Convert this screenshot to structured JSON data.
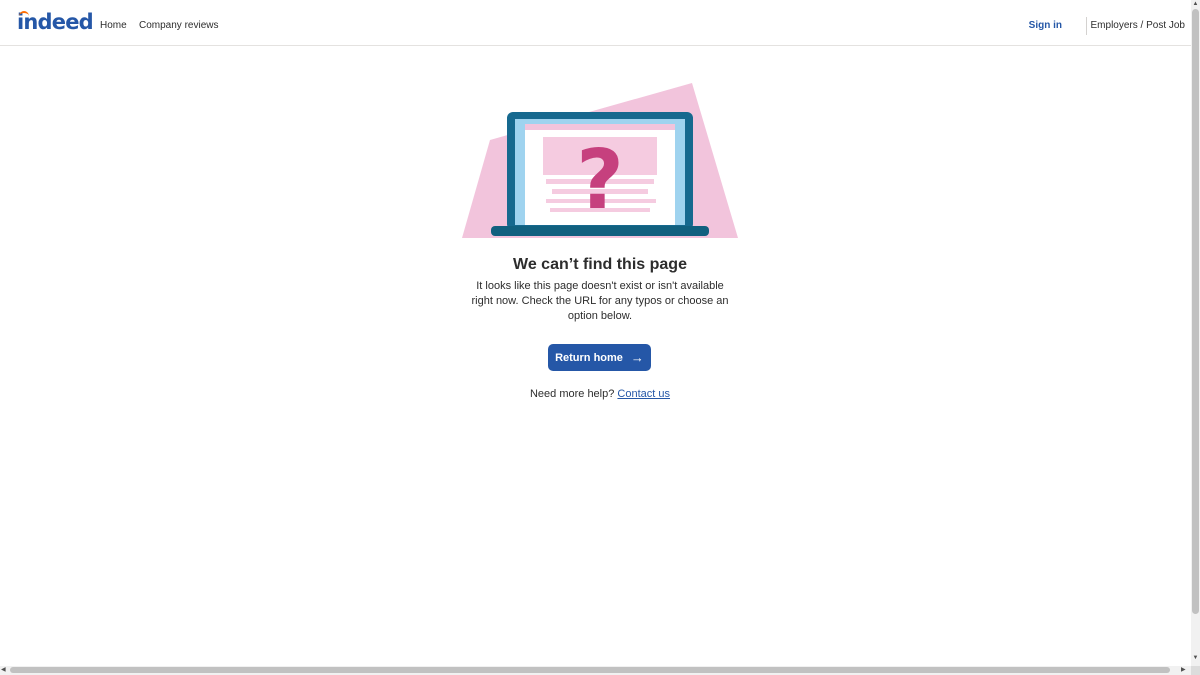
{
  "header": {
    "logo_text": "indeed",
    "nav": {
      "home": "Home",
      "company_reviews": "Company reviews"
    },
    "sign_in": "Sign in",
    "employers": "Employers / Post Job"
  },
  "error": {
    "title": "We can’t find this page",
    "description": "It looks like this page doesn't exist or isn't available right now. Check the URL for any typos or choose an option below.",
    "button_label": "Return home",
    "help_text": "Need more help?",
    "contact_link": "Contact us"
  },
  "colors": {
    "brand": "#2557a7",
    "illustration_pink": "#f2c4dc",
    "laptop_blue": "#1a6ea1",
    "question_mark": "#c6407e"
  },
  "icons": {
    "button_arrow": "arrow-right-icon",
    "illustration": "laptop-question-mark-icon"
  }
}
